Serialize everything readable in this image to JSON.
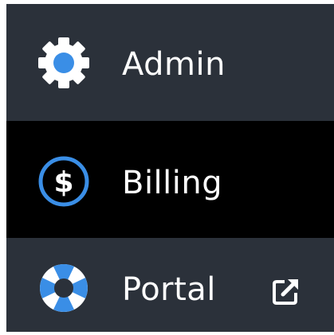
{
  "menu": {
    "items": [
      {
        "label": "Admin",
        "icon": "gear-icon",
        "active": false
      },
      {
        "label": "Billing",
        "icon": "dollar-icon",
        "active": true
      },
      {
        "label": "Portal",
        "icon": "lifebuoy-icon",
        "active": false,
        "external": true,
        "trailing_icon": "external-link-icon"
      }
    ]
  },
  "colors": {
    "sidebar_bg": "#2b313a",
    "active_bg": "#000000",
    "accent_blue": "#3a8ee6",
    "text": "#ffffff"
  }
}
